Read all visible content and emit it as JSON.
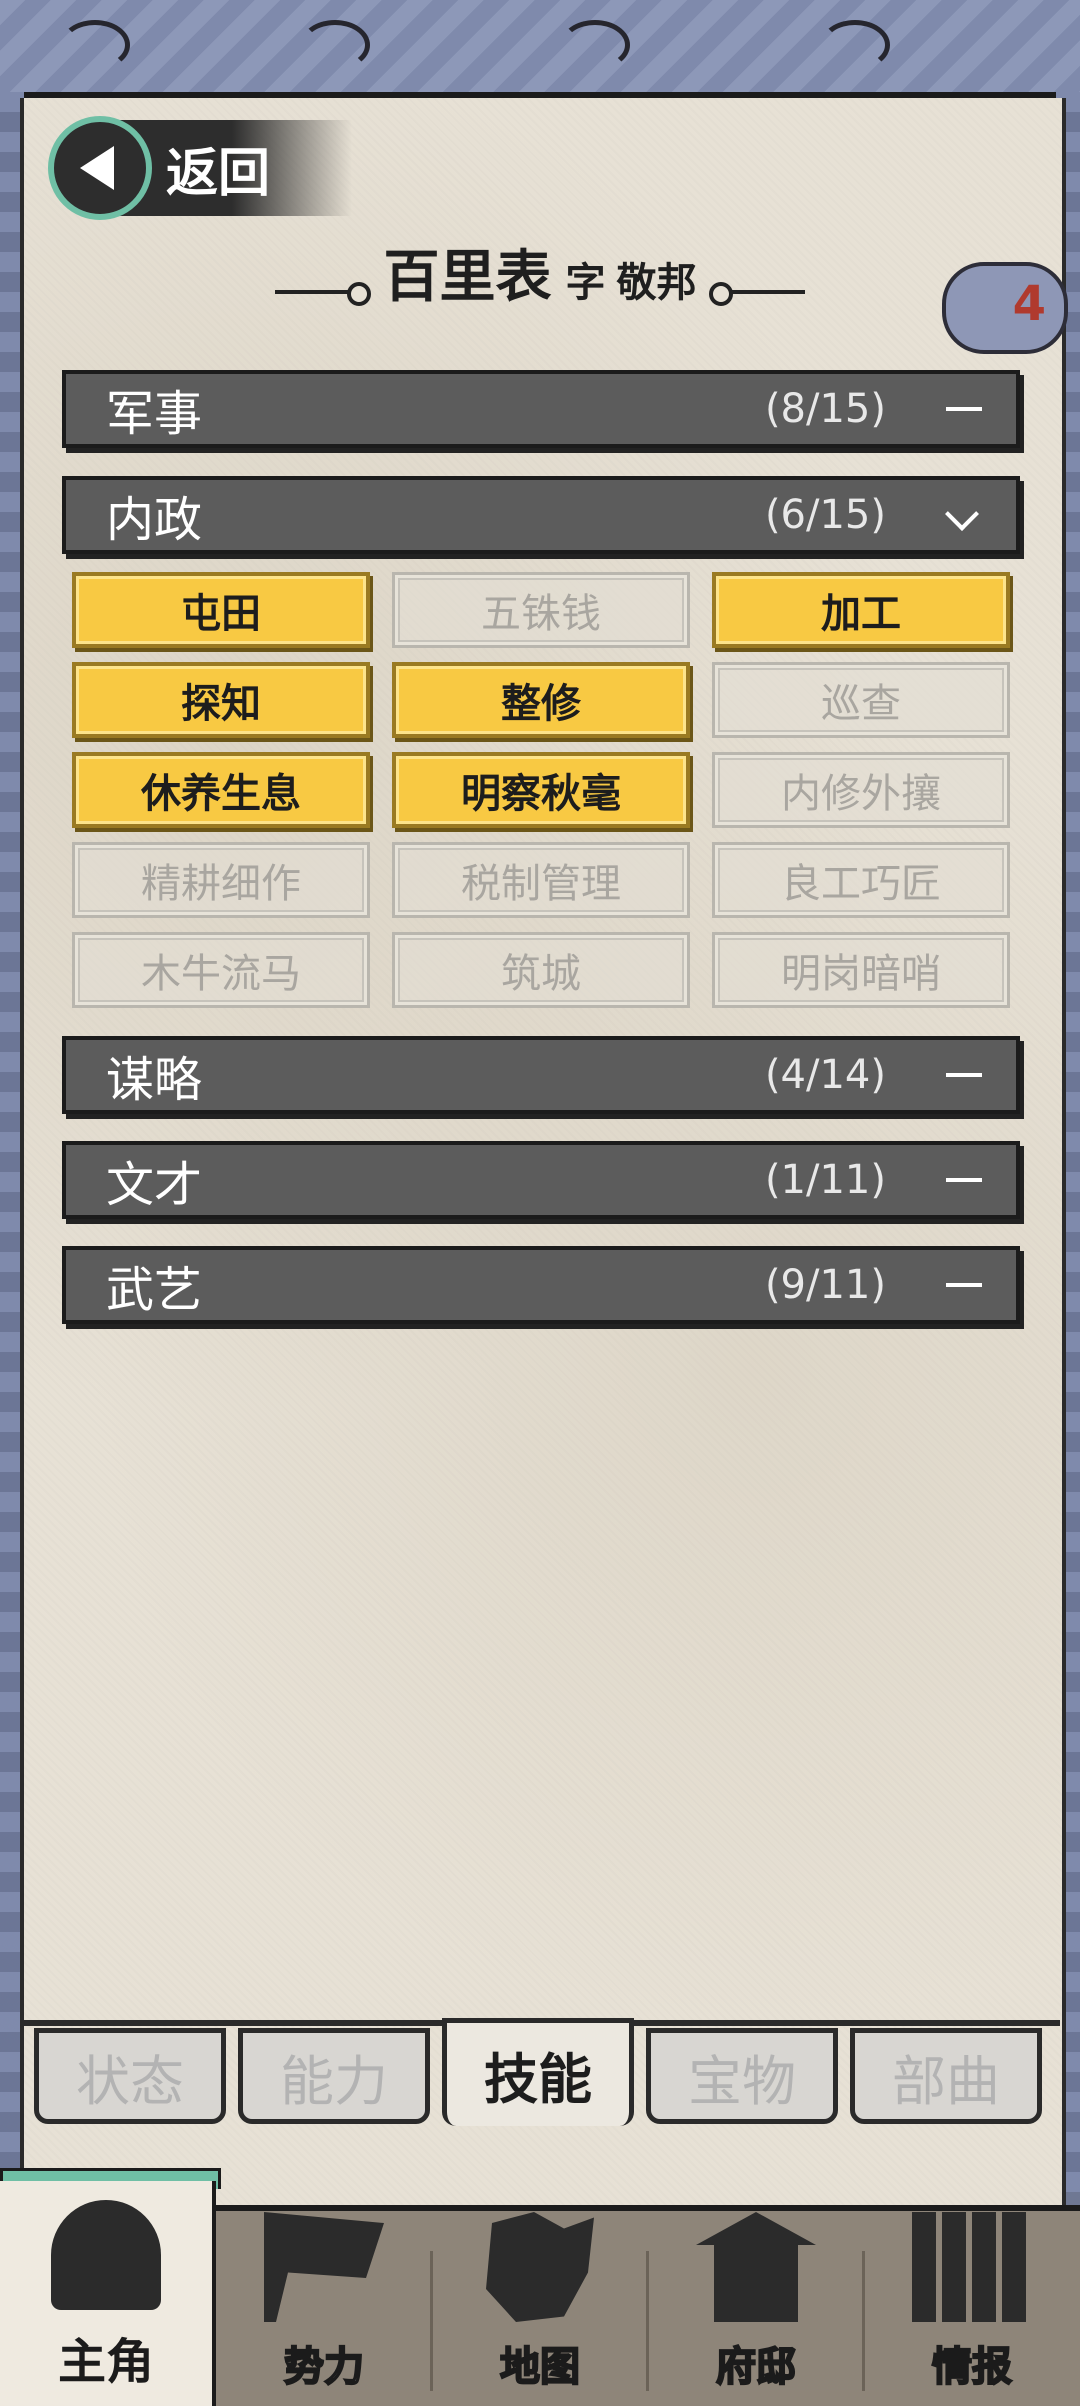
{
  "header": {
    "back_label": "返回",
    "name": "百里表",
    "zi_label": "字",
    "zi": "敬邦",
    "badge_count": "4"
  },
  "categories": [
    {
      "label": "军事",
      "count": "(8/15)",
      "state": "collapsed"
    },
    {
      "label": "内政",
      "count": "(6/15)",
      "state": "expanded"
    },
    {
      "label": "谋略",
      "count": "(4/14)",
      "state": "collapsed"
    },
    {
      "label": "文才",
      "count": "(1/11)",
      "state": "collapsed"
    },
    {
      "label": "武艺",
      "count": "(9/11)",
      "state": "collapsed"
    }
  ],
  "skills": [
    {
      "label": "屯田",
      "learned": true
    },
    {
      "label": "五铢钱",
      "learned": false
    },
    {
      "label": "加工",
      "learned": true
    },
    {
      "label": "探知",
      "learned": true
    },
    {
      "label": "整修",
      "learned": true
    },
    {
      "label": "巡查",
      "learned": false
    },
    {
      "label": "休养生息",
      "learned": true
    },
    {
      "label": "明察秋毫",
      "learned": true
    },
    {
      "label": "内修外攘",
      "learned": false
    },
    {
      "label": "精耕细作",
      "learned": false
    },
    {
      "label": "税制管理",
      "learned": false
    },
    {
      "label": "良工巧匠",
      "learned": false
    },
    {
      "label": "木牛流马",
      "learned": false
    },
    {
      "label": "筑城",
      "learned": false
    },
    {
      "label": "明岗暗哨",
      "learned": false
    }
  ],
  "tabs": [
    {
      "label": "状态",
      "active": false
    },
    {
      "label": "能力",
      "active": false
    },
    {
      "label": "技能",
      "active": true
    },
    {
      "label": "宝物",
      "active": false
    },
    {
      "label": "部曲",
      "active": false
    }
  ],
  "bottom_nav": [
    {
      "label": "主角",
      "icon": "hero-icon",
      "active": true
    },
    {
      "label": "势力",
      "icon": "flag-icon",
      "active": false
    },
    {
      "label": "地图",
      "icon": "map-icon",
      "active": false
    },
    {
      "label": "府邸",
      "icon": "mansion-icon",
      "active": false
    },
    {
      "label": "情报",
      "icon": "scroll-icon",
      "active": false
    }
  ],
  "colors": {
    "skill_learned": "#f8c943",
    "bar": "#5c5c5c",
    "paper": "#e7e1d5",
    "accent_green": "#6fbfa5",
    "badge_text": "#b03a2e"
  }
}
